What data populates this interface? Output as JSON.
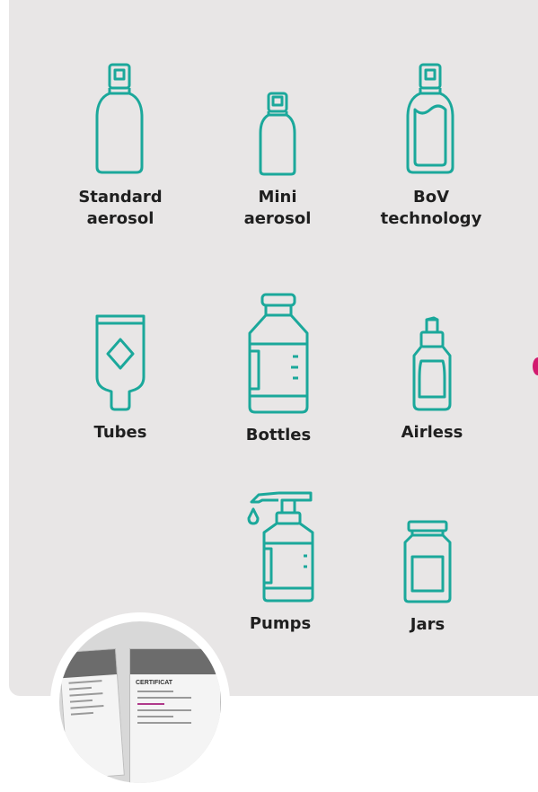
{
  "accent_color": "#1ba89b",
  "items": [
    {
      "label": "Standard\naerosol",
      "icon": "standard-aerosol-icon"
    },
    {
      "label": "Mini\naerosol",
      "icon": "mini-aerosol-icon"
    },
    {
      "label": "BoV\ntechnology",
      "icon": "bov-technology-icon"
    },
    {
      "label": "Tubes",
      "icon": "tube-icon"
    },
    {
      "label": "Bottles",
      "icon": "bottle-icon"
    },
    {
      "label": "Airless",
      "icon": "airless-icon"
    },
    {
      "label": "Pumps",
      "icon": "pump-bottle-icon"
    },
    {
      "label": "Jars",
      "icon": "jar-icon"
    }
  ],
  "photo": {
    "doc_title": "CERTIFICAT"
  }
}
